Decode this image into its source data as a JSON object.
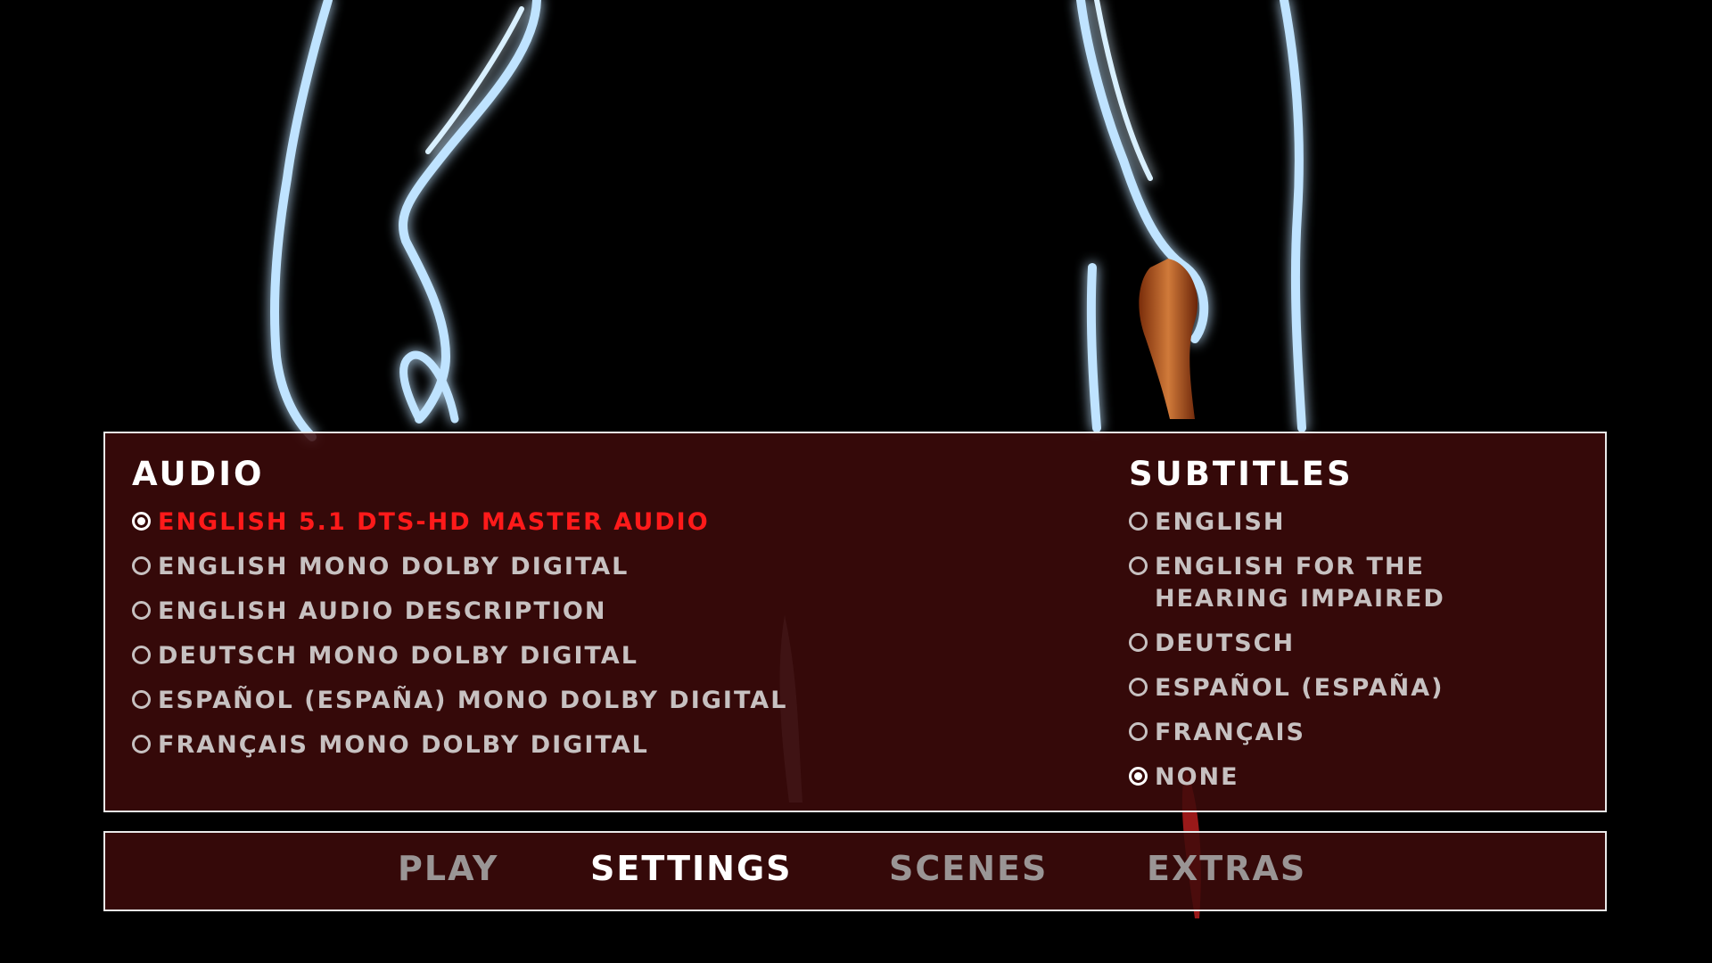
{
  "audio": {
    "title": "AUDIO",
    "options": [
      {
        "label": "ENGLISH 5.1 DTS-HD MASTER AUDIO"
      },
      {
        "label": "ENGLISH MONO DOLBY DIGITAL"
      },
      {
        "label": "ENGLISH AUDIO DESCRIPTION"
      },
      {
        "label": "DEUTSCH MONO DOLBY DIGITAL"
      },
      {
        "label": "ESPAÑOL (ESPAÑA) MONO DOLBY DIGITAL"
      },
      {
        "label": "FRANÇAIS MONO DOLBY DIGITAL"
      }
    ],
    "selected_option": "ENGLISH 5.1 DTS-HD MASTER AUDIO"
  },
  "subtitles": {
    "title": "SUBTITLES",
    "options": [
      {
        "label": "ENGLISH"
      },
      {
        "label": "ENGLISH FOR THE\nHEARING IMPAIRED"
      },
      {
        "label": "DEUTSCH"
      },
      {
        "label": "ESPAÑOL (ESPAÑA)"
      },
      {
        "label": "FRANÇAIS"
      },
      {
        "label": "NONE"
      }
    ],
    "selected_option": "NONE"
  },
  "nav": {
    "play": "PLAY",
    "settings": "SETTINGS",
    "scenes": "SCENES",
    "extras": "EXTRAS",
    "current": "SETTINGS"
  },
  "colors": {
    "highlight": "#ff1a1a",
    "panel_bg": "#3e0a0a",
    "glow": "#bfe3ff"
  },
  "icons": [
    "radio-button-icon"
  ]
}
